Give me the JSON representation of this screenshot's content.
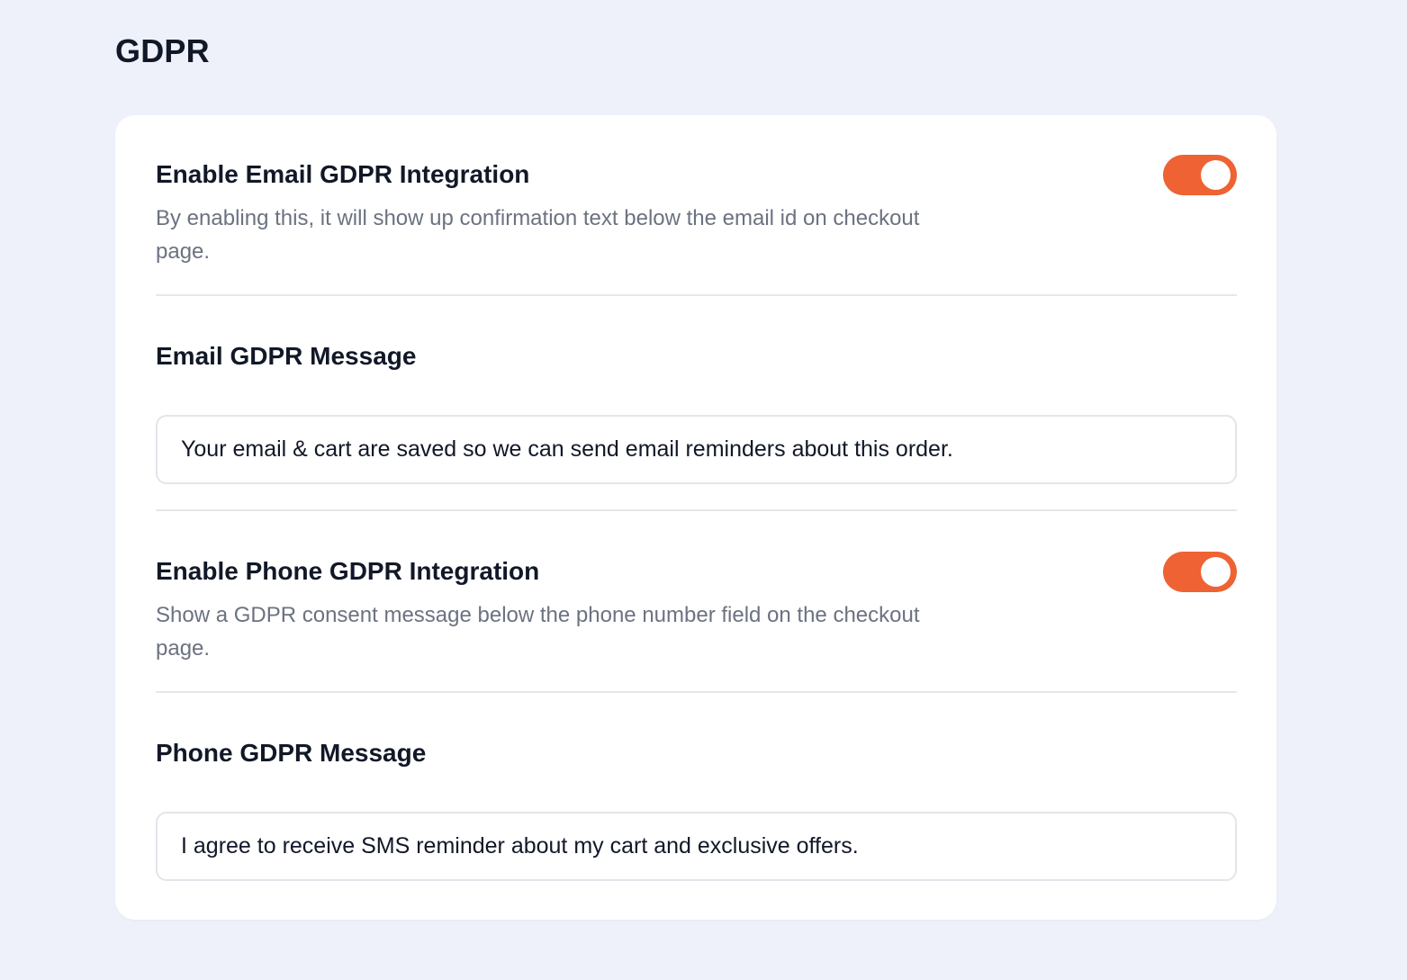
{
  "page": {
    "title": "GDPR"
  },
  "colors": {
    "background": "#eef1f9",
    "card": "#ffffff",
    "accent": "#ee6233",
    "text_primary": "#111827",
    "text_secondary": "#6b7280"
  },
  "email_gdpr": {
    "toggle_title": "Enable Email GDPR Integration",
    "toggle_description": "By enabling this, it will show up confirmation text below the email id on checkout page.",
    "toggle_state": "on",
    "message_label": "Email GDPR Message",
    "message_value": "Your email & cart are saved so we can send email reminders about this order."
  },
  "phone_gdpr": {
    "toggle_title": "Enable Phone GDPR Integration",
    "toggle_description": "Show a GDPR consent message below the phone number field on the checkout page.",
    "toggle_state": "on",
    "message_label": "Phone GDPR Message",
    "message_value": "I agree to receive SMS reminder about my cart and exclusive offers."
  }
}
